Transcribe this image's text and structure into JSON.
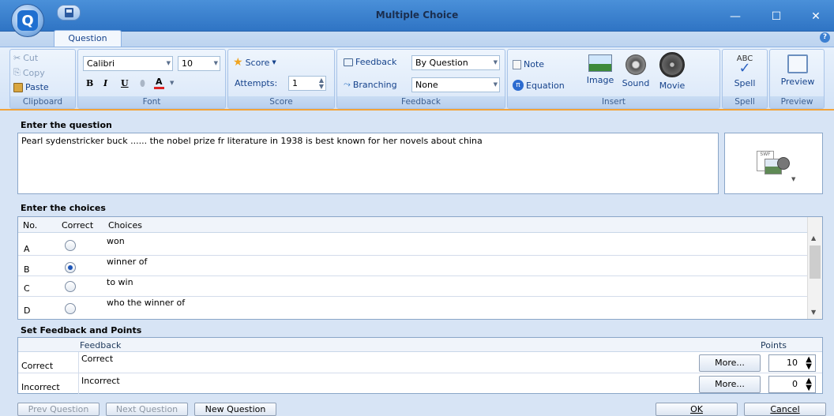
{
  "window": {
    "title": "Multiple Choice",
    "minimize": "—",
    "maximize": "☐",
    "close": "✕"
  },
  "tabs": {
    "question": "Question"
  },
  "ribbon": {
    "clipboard": {
      "cut": "Cut",
      "copy": "Copy",
      "paste": "Paste",
      "label": "Clipboard"
    },
    "font": {
      "family": "Calibri",
      "size": "10",
      "bold": "B",
      "italic": "I",
      "underline": "U",
      "color_letter": "A",
      "label": "Font"
    },
    "score": {
      "score_label": "Score",
      "attempts_label": "Attempts:",
      "attempts_value": "1",
      "label": "Score"
    },
    "feedback": {
      "feedback_label": "Feedback",
      "feedback_value": "By Question",
      "branching_label": "Branching",
      "branching_value": "None",
      "label": "Feedback"
    },
    "insert": {
      "note": "Note",
      "equation": "Equation",
      "image": "Image",
      "sound": "Sound",
      "movie": "Movie",
      "label": "Insert"
    },
    "spell": {
      "spell": "Spell",
      "label": "Spell",
      "abc": "ABC"
    },
    "preview": {
      "preview": "Preview",
      "label": "Preview"
    }
  },
  "question": {
    "heading": "Enter the question",
    "text": "Pearl sydenstricker buck ...... the nobel prize fr literature in 1938 is best known for her novels about china"
  },
  "choices": {
    "heading": "Enter the choices",
    "columns": {
      "no": "No.",
      "correct": "Correct",
      "choices": "Choices"
    },
    "rows": [
      {
        "no": "A",
        "text": "won",
        "correct": false
      },
      {
        "no": "B",
        "text": "winner of",
        "correct": true
      },
      {
        "no": "C",
        "text": "to win",
        "correct": false
      },
      {
        "no": "D",
        "text": "who the winner of",
        "correct": false
      }
    ]
  },
  "feedback_points": {
    "heading": "Set Feedback and Points",
    "columns": {
      "feedback": "Feedback",
      "points": "Points"
    },
    "rows": [
      {
        "label": "Correct",
        "feedback": "Correct",
        "more": "More...",
        "points": "10"
      },
      {
        "label": "Incorrect",
        "feedback": "Incorrect",
        "more": "More...",
        "points": "0"
      }
    ]
  },
  "footer": {
    "prev": "Prev Question",
    "next": "Next Question",
    "new": "New Question",
    "ok": "OK",
    "cancel": "Cancel"
  },
  "colors": {
    "accent": "#f2a33a",
    "title_bar": "#3a80cf",
    "panel": "#d7e4f5"
  }
}
